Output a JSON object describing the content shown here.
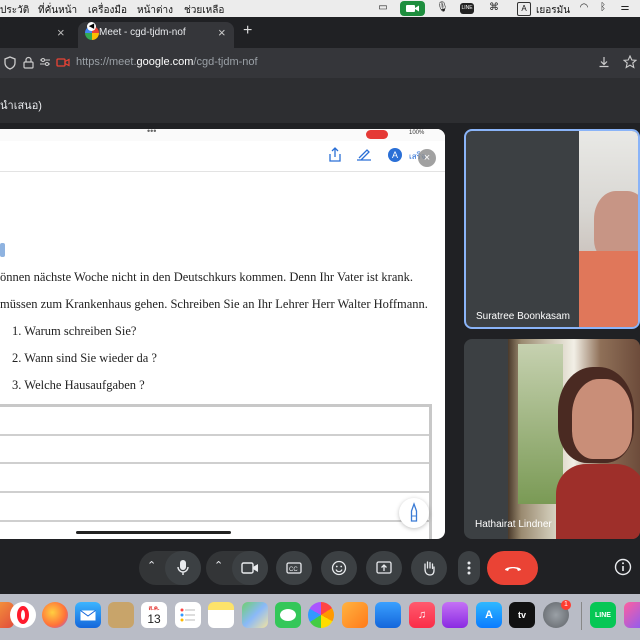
{
  "menubar": {
    "items": [
      "ประวัติ",
      "ที่คั่นหน้า",
      "เครื่องมือ",
      "หน้าต่าง",
      "ช่วยเหลือ"
    ],
    "input_source": "เยอรมัน",
    "input_source_badge": "A"
  },
  "browser": {
    "tab_title": "Meet - cgd-tjdm-nof",
    "url_prefix": "https://meet.",
    "url_domain": "google.com",
    "url_path": "/cgd-tjdm-nof",
    "new_tab_symbol": "+",
    "close_symbol": "×"
  },
  "presentation_bar": {
    "label": "นำเสนอ)"
  },
  "document": {
    "status_battery": "100%",
    "present_label": "เสร็จ",
    "lines": [
      "önnen nächste Woche nicht in den Deutschkurs kommen. Denn Ihr Vater ist krank.",
      "müssen zum Krankenhaus gehen. Schreiben Sie an Ihr Lehrer Herr Walter Hoffmann."
    ],
    "questions": [
      "1. Warum schreiben Sie?",
      "2. Wann sind Sie wieder da  ?",
      "3. Welche Hausaufgaben ?"
    ]
  },
  "participants": [
    {
      "name": "Suratree Boonkasam"
    },
    {
      "name": "Hathairat Lindner"
    }
  ],
  "controls": {
    "end_call_color": "#ea4335",
    "accent_color": "#8ab4f8"
  },
  "dock": {
    "calendar_month": "ส.ค.",
    "calendar_day": "13",
    "settings_badge": "1",
    "tv_label": "tv",
    "line_label": "LINE"
  },
  "colors": {
    "meet_green": "#1e8e3e",
    "window_bg": "#202124"
  }
}
